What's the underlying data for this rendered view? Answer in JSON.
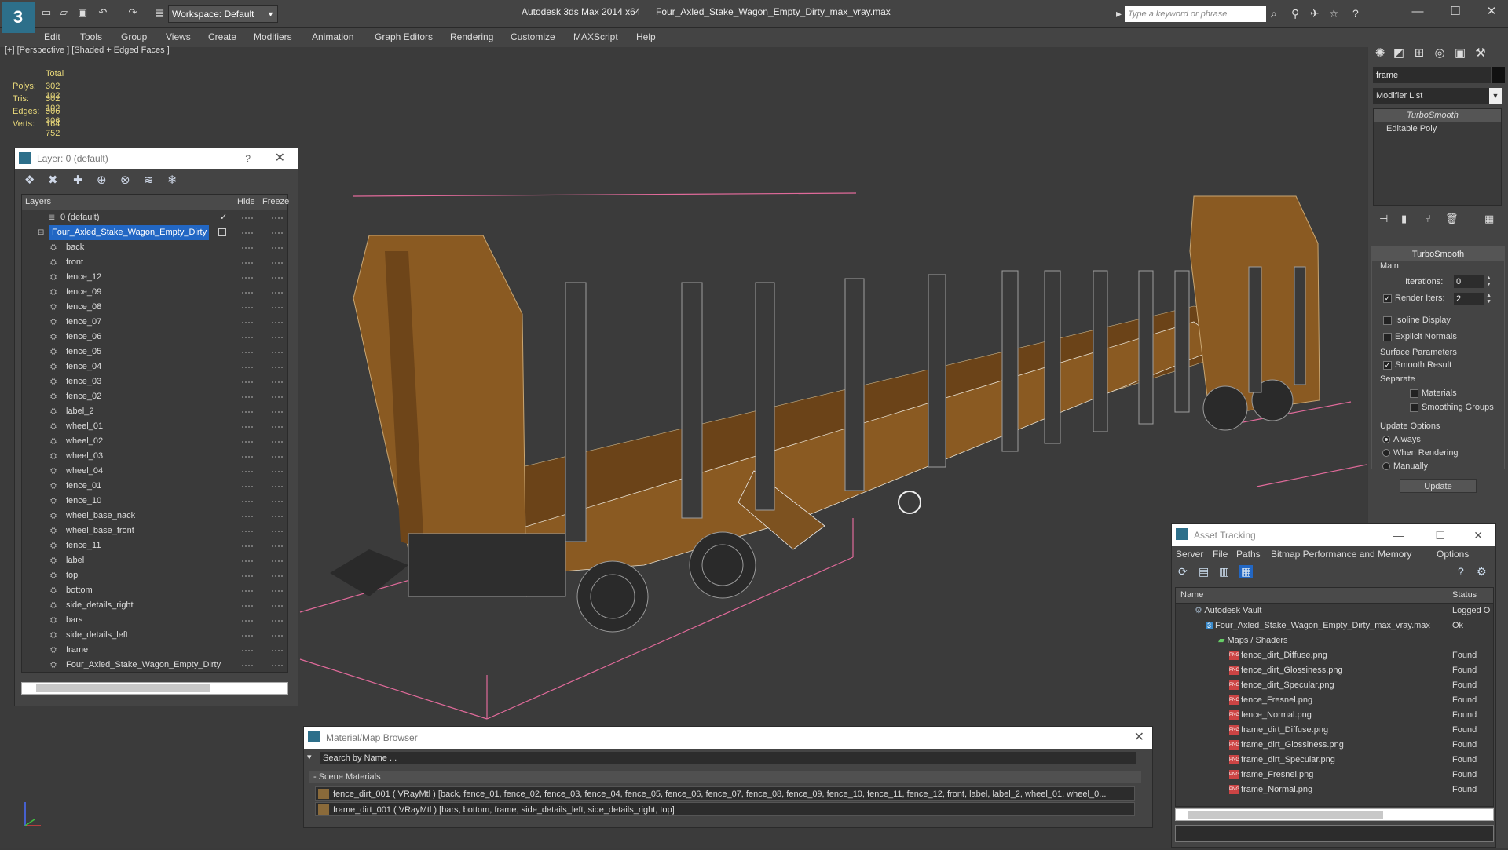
{
  "titlebar": {
    "workspace": "Workspace: Default",
    "app_title": "Autodesk 3ds Max  2014 x64",
    "file_title": "Four_Axled_Stake_Wagon_Empty_Dirty_max_vray.max",
    "search_placeholder": "Type a keyword or phrase"
  },
  "menu": [
    "Edit",
    "Tools",
    "Group",
    "Views",
    "Create",
    "Modifiers",
    "Animation",
    "Graph Editors",
    "Rendering",
    "Customize",
    "MAXScript",
    "Help"
  ],
  "viewport": {
    "label": "[+] [Perspective ] [Shaded + Edged Faces ]",
    "stats": {
      "header": "Total",
      "rows": [
        {
          "label": "Polys:",
          "value": "302 102"
        },
        {
          "label": "Tris:",
          "value": "302 102"
        },
        {
          "label": "Edges:",
          "value": "906 306"
        },
        {
          "label": "Verts:",
          "value": "164 752"
        }
      ]
    }
  },
  "layer_window": {
    "title": "Layer: 0 (default)",
    "help": "?",
    "columns": {
      "layers": "Layers",
      "hide": "Hide",
      "freeze": "Freeze"
    },
    "layers": [
      "0 (default)",
      "Four_Axled_Stake_Wagon_Empty_Dirty",
      "back",
      "front",
      "fence_12",
      "fence_09",
      "fence_08",
      "fence_07",
      "fence_06",
      "fence_05",
      "fence_04",
      "fence_03",
      "fence_02",
      "label_2",
      "wheel_01",
      "wheel_02",
      "wheel_03",
      "wheel_04",
      "fence_01",
      "fence_10",
      "wheel_base_nack",
      "wheel_base_front",
      "fence_11",
      "label",
      "top",
      "bottom",
      "side_details_right",
      "bars",
      "side_details_left",
      "frame",
      "Four_Axled_Stake_Wagon_Empty_Dirty"
    ]
  },
  "command_panel": {
    "object_name": "frame",
    "modifier_list": "Modifier List",
    "stack": [
      "TurboSmooth",
      "Editable Poly"
    ],
    "turbosmooth": {
      "title": "TurboSmooth",
      "main": "Main",
      "iterations_label": "Iterations:",
      "iterations": "0",
      "render_iters_label": "Render Iters:",
      "render_iters": "2",
      "isoline": "Isoline Display",
      "explicit": "Explicit Normals",
      "surface": "Surface Parameters",
      "smooth_result": "Smooth Result",
      "separate": "Separate",
      "materials": "Materials",
      "smoothing_groups": "Smoothing Groups",
      "update_options": "Update Options",
      "always": "Always",
      "when_rendering": "When Rendering",
      "manually": "Manually",
      "update": "Update"
    }
  },
  "asset_tracking": {
    "title": "Asset Tracking",
    "menu": [
      "Server",
      "File",
      "Paths",
      "Bitmap Performance and Memory",
      "Options"
    ],
    "columns": {
      "name": "Name",
      "status": "Status"
    },
    "rows": [
      {
        "name": "Autodesk Vault",
        "status": "Logged O"
      },
      {
        "name": "Four_Axled_Stake_Wagon_Empty_Dirty_max_vray.max",
        "status": "Ok"
      },
      {
        "name": "Maps / Shaders",
        "status": ""
      },
      {
        "name": "fence_dirt_Diffuse.png",
        "status": "Found"
      },
      {
        "name": "fence_dirt_Glossiness.png",
        "status": "Found"
      },
      {
        "name": "fence_dirt_Specular.png",
        "status": "Found"
      },
      {
        "name": "fence_Fresnel.png",
        "status": "Found"
      },
      {
        "name": "fence_Normal.png",
        "status": "Found"
      },
      {
        "name": "frame_dirt_Diffuse.png",
        "status": "Found"
      },
      {
        "name": "frame_dirt_Glossiness.png",
        "status": "Found"
      },
      {
        "name": "frame_dirt_Specular.png",
        "status": "Found"
      },
      {
        "name": "frame_Fresnel.png",
        "status": "Found"
      },
      {
        "name": "frame_Normal.png",
        "status": "Found"
      }
    ]
  },
  "material_browser": {
    "title": "Material/Map Browser",
    "search_placeholder": "Search by Name ...",
    "section": "- Scene Materials",
    "materials": [
      "fence_dirt_001  ( VRayMtl )  [back, fence_01, fence_02, fence_03, fence_04, fence_05, fence_06, fence_07, fence_08, fence_09, fence_10, fence_11, fence_12, front, label, label_2, wheel_01, wheel_0...",
      "frame_dirt_001  ( VRayMtl ) [bars, bottom, frame, side_details_left, side_details_right, top]"
    ]
  },
  "colors": {
    "accent": "#2267c4",
    "wood": "#8a5a22",
    "stats": "#e9d97a"
  }
}
